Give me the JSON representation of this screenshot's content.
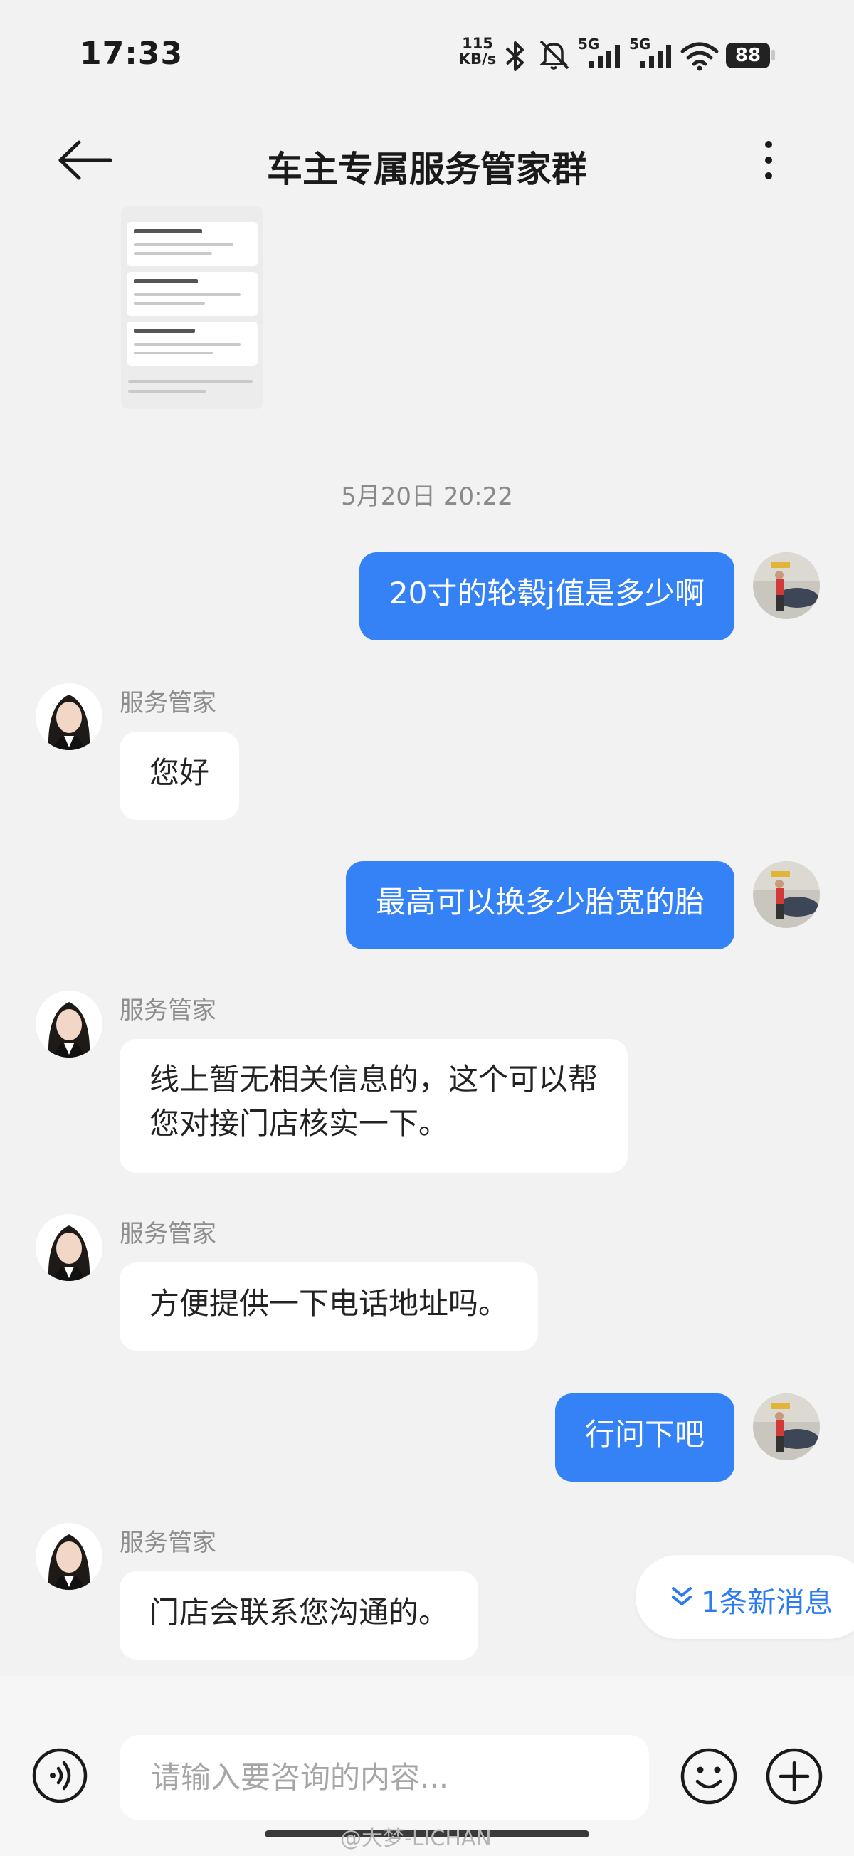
{
  "status_bar": {
    "time": "17:33",
    "net_speed_value": "115",
    "net_speed_unit": "KB/s",
    "signal_1_label": "5G",
    "signal_2_label": "5G",
    "battery": "88",
    "icons": [
      "bluetooth-icon",
      "mute-icon",
      "signal-icon",
      "signal-icon",
      "wifi-icon",
      "battery-icon"
    ]
  },
  "header": {
    "title": "车主专属服务管家群",
    "back_icon": "arrow-left-icon",
    "more_icon": "more-vertical-icon"
  },
  "chat": {
    "timestamp": "5月20日 20:22",
    "messages": [
      {
        "direction": "out",
        "text": "20寸的轮毂j值是多少啊"
      },
      {
        "direction": "in",
        "sender": "服务管家",
        "text": "您好"
      },
      {
        "direction": "out",
        "text": "最高可以换多少胎宽的胎"
      },
      {
        "direction": "in",
        "sender": "服务管家",
        "lines": [
          "线上暂无相关信息的，这个可以帮",
          "您对接门店核实一下。"
        ]
      },
      {
        "direction": "in",
        "sender": "服务管家",
        "text": "方便提供一下电话地址吗。"
      },
      {
        "direction": "out",
        "text": "行问下吧"
      },
      {
        "direction": "in",
        "sender": "服务管家",
        "text": "门店会联系您沟通的。"
      }
    ],
    "new_messages_label": "1条新消息"
  },
  "input_bar": {
    "placeholder": "请输入要咨询的内容...",
    "voice_icon": "voice-icon",
    "emoji_icon": "emoji-icon",
    "plus_icon": "plus-icon"
  },
  "watermark": "@大梦-LICHAN",
  "colors": {
    "outgoing_bubble": "#3482f6",
    "incoming_bubble": "#ffffff",
    "background": "#f2f2f2",
    "accent_link": "#2b7cf0"
  }
}
